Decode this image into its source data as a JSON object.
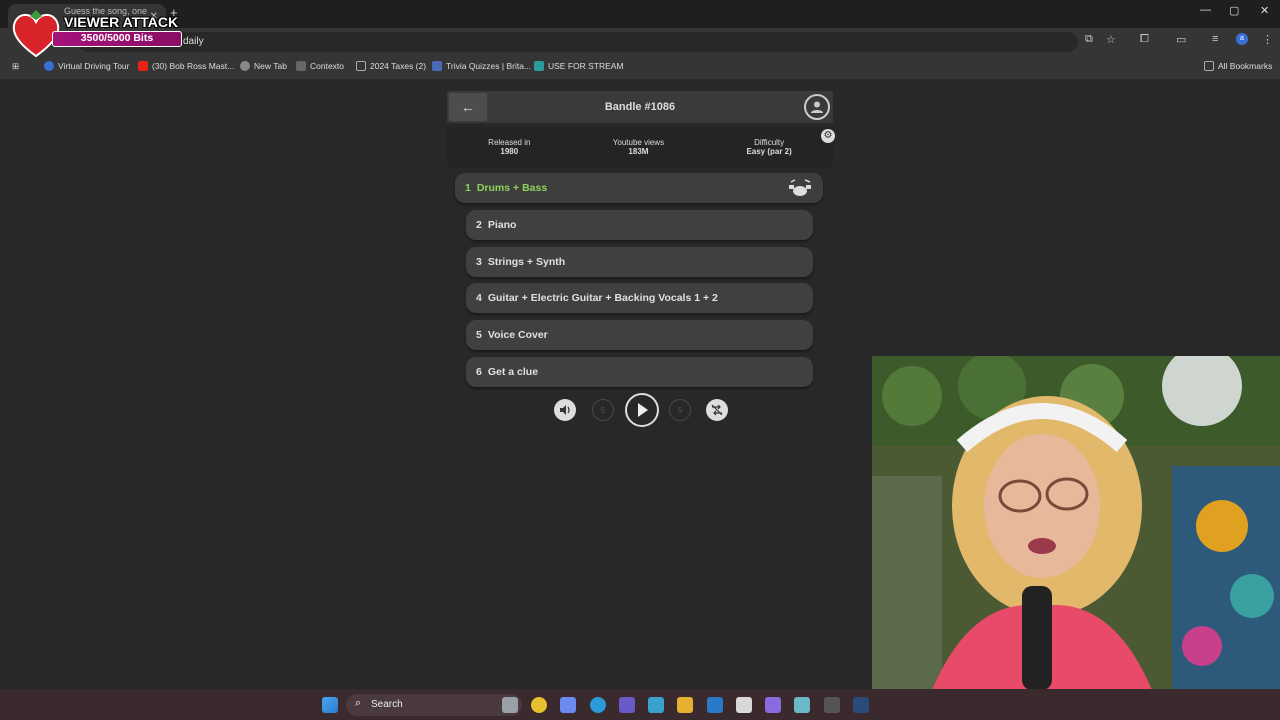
{
  "browser": {
    "tab_title": "Guess the song, one in...",
    "tab_close": "✕",
    "new_tab": "+",
    "address": "daily",
    "window_controls": [
      "—",
      "▢",
      "✕"
    ],
    "bookmarks": [
      {
        "label": "Virtual Driving Tour",
        "icon": "globe-icon",
        "color": "#3a6fd8"
      },
      {
        "label": "(30) Bob Ross Mast...",
        "icon": "youtube-icon",
        "color": "#e62117"
      },
      {
        "label": "New Tab",
        "icon": "chrome-icon",
        "color": "#888888"
      },
      {
        "label": "Contexto",
        "icon": "contexto-icon",
        "color": "#666666"
      },
      {
        "label": "2024 Taxes (2)",
        "icon": "folder-icon",
        "color": "#777777"
      },
      {
        "label": "Trivia Quizzes | Brita...",
        "icon": "britannica-icon",
        "color": "#4a6ab8"
      },
      {
        "label": "USE FOR STREAM",
        "icon": "pi-icon",
        "color": "#2a9a9a"
      }
    ],
    "all_bookmarks": "All Bookmarks"
  },
  "overlay": {
    "title": "VIEWER ATTACK",
    "bits": "3500/5000 Bits",
    "progress": 0.7,
    "color": "#a4127a"
  },
  "app": {
    "title": "Bandle #1086",
    "released_label": "Released in",
    "released_value": "1980",
    "views_label": "Youtube views",
    "views_value": "183M",
    "difficulty_label": "Difficulty",
    "difficulty_value": "Easy (par 2)",
    "tracks": [
      {
        "num": "1",
        "label": "Drums + Bass",
        "active": true
      },
      {
        "num": "2",
        "label": "Piano",
        "active": false
      },
      {
        "num": "3",
        "label": "Strings + Synth",
        "active": false
      },
      {
        "num": "4",
        "label": "Guitar + Electric Guitar + Backing Vocals 1 + 2",
        "active": false
      },
      {
        "num": "5",
        "label": "Voice Cover",
        "active": false
      },
      {
        "num": "6",
        "label": "Get a clue",
        "active": false
      }
    ],
    "active_color": "#8cd35a",
    "controls": [
      "volume-icon",
      "rewind-5-icon",
      "play-icon",
      "forward-5-icon",
      "skip-icon"
    ],
    "skip_label": "5"
  },
  "taskbar": {
    "search_label": "Search"
  }
}
